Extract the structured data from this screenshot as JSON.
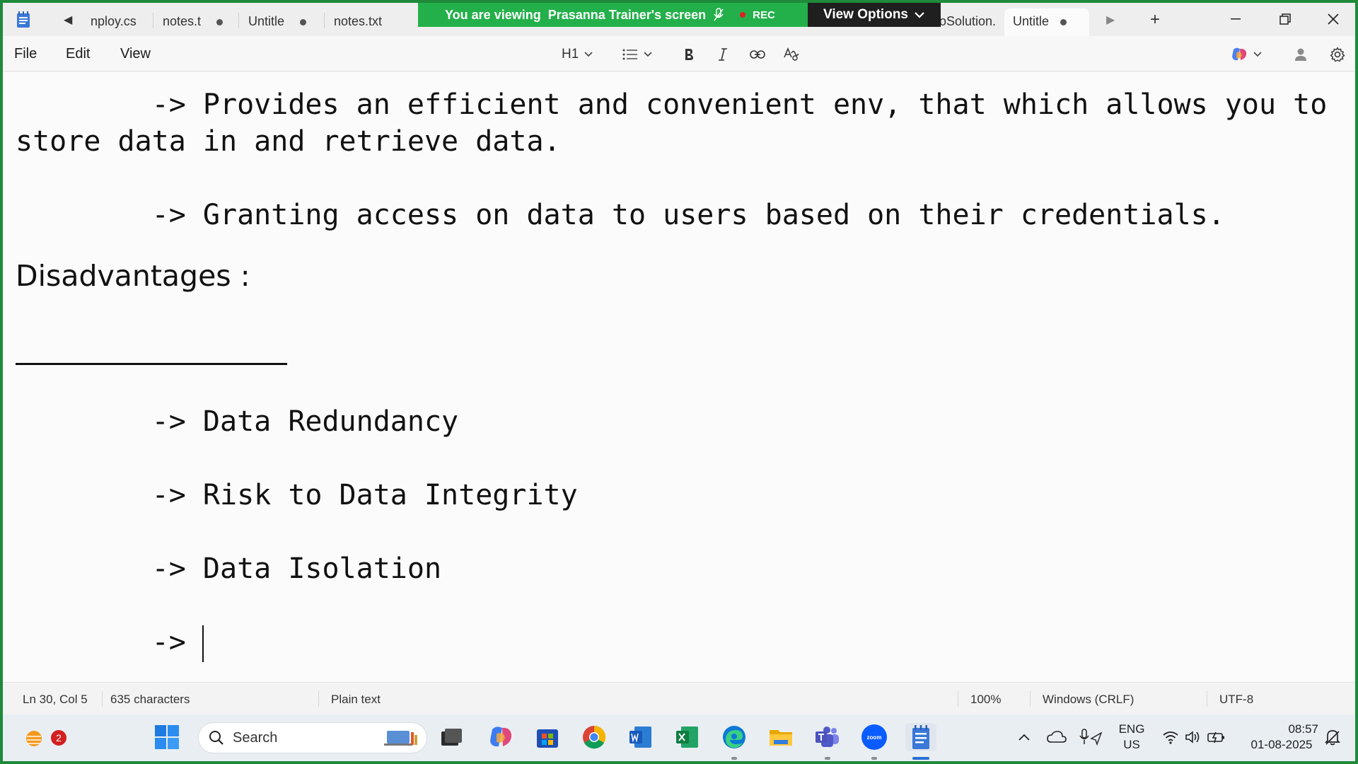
{
  "tabs": [
    {
      "label": "nploy.cs",
      "modified": false
    },
    {
      "label": "notes.t",
      "modified": true
    },
    {
      "label": "Untitle",
      "modified": true
    },
    {
      "label": "notes.txt",
      "modified": false
    },
    {
      "label": "oSolution.",
      "modified": false
    },
    {
      "label": "Untitle",
      "modified": true,
      "active": true
    }
  ],
  "share_banner": {
    "prefix": "You are viewing",
    "name": "Prasanna Trainer's screen",
    "rec": "REC",
    "view_options": "View Options"
  },
  "menu": {
    "file": "File",
    "edit": "Edit",
    "view": "View"
  },
  "toolbar": {
    "heading": "H1"
  },
  "document": {
    "lines": [
      "        -> Provides an efficient and convenient env, that which allows you to",
      "store data in and retrieve data.",
      "        -> Granting access on data to users based on their credentials.",
      "Disadvantages :",
      "        -> Data Redundancy",
      "        -> Risk to Data Integrity",
      "        -> Data Isolation",
      "        -> "
    ]
  },
  "status": {
    "position": "Ln 30, Col 5",
    "characters": "635 characters",
    "format": "Plain text",
    "zoom": "100%",
    "line_ending": "Windows (CRLF)",
    "encoding": "UTF-8"
  },
  "taskbar": {
    "widgets_badge": "2",
    "search_placeholder": "Search",
    "language": "ENG",
    "region": "US",
    "time": "08:57",
    "date": "01-08-2025"
  },
  "colors": {
    "border_green": "#1e8a3a",
    "banner_green": "#23b04a",
    "rec_red": "#e02020"
  }
}
